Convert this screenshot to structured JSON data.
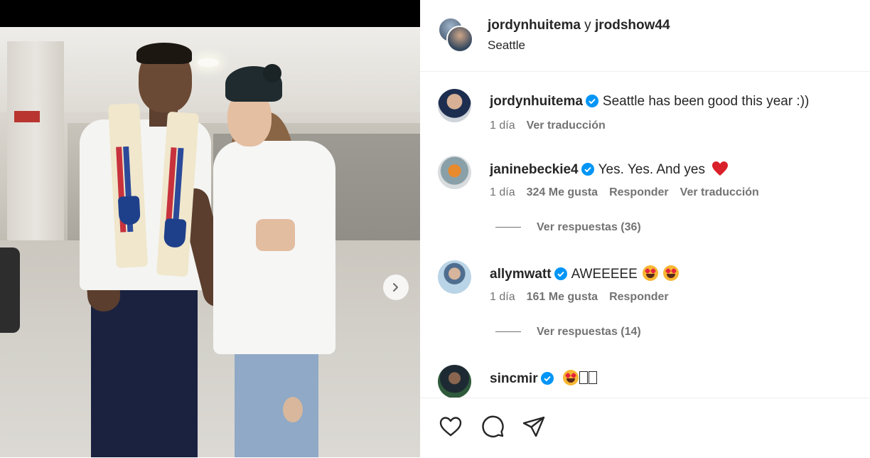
{
  "post": {
    "header": {
      "user1": "jordynhuitema",
      "conj": " y ",
      "user2": "jrodshow44",
      "location": "Seattle"
    },
    "comments": [
      {
        "username": "jordynhuitema",
        "verified": true,
        "text": "Seattle has been good this year :))",
        "time": "1 día",
        "translate": "Ver traducción"
      },
      {
        "username": "janinebeckie4",
        "verified": true,
        "text": "Yes. Yes. And yes",
        "emoji": "heart",
        "time": "1 día",
        "likes": "324 Me gusta",
        "reply": "Responder",
        "translate": "Ver traducción",
        "view_replies": "Ver respuestas (36)"
      },
      {
        "username": "allymwatt",
        "verified": true,
        "text": "AWEEEEE",
        "emoji": "star-struck x2",
        "time": "1 día",
        "likes": "161 Me gusta",
        "reply": "Responder",
        "view_replies": "Ver respuestas (14)"
      },
      {
        "username": "sincmir",
        "verified": true,
        "emoji": "star-struck + 2 missing glyphs"
      }
    ],
    "actions": {
      "like_icon": "heart-outline-icon",
      "comment_icon": "speech-bubble-icon",
      "share_icon": "paper-plane-icon"
    }
  },
  "colors": {
    "verified": "#0095f6",
    "secondary_text": "#737373",
    "heart": "#d9202b"
  }
}
